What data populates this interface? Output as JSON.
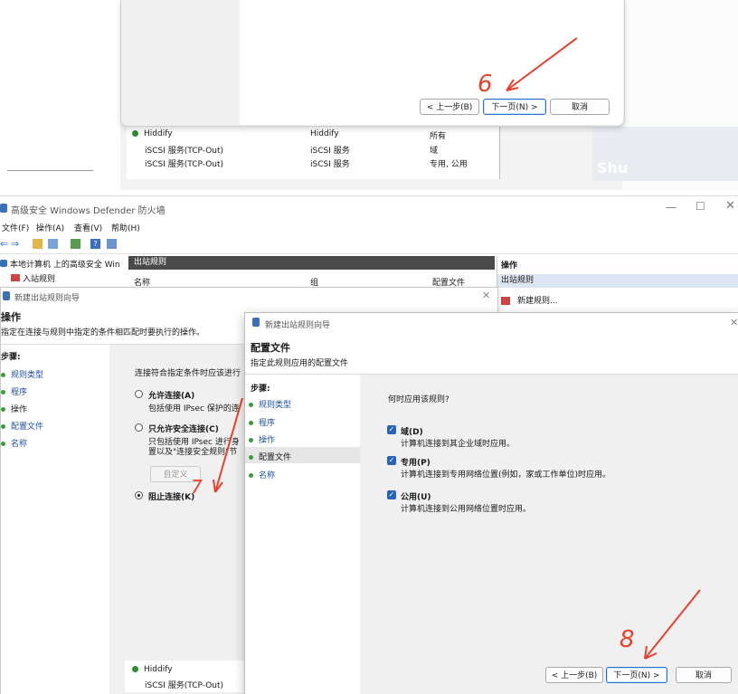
{
  "top_dialog": {
    "back_button": "< 上一步(B)",
    "next_button": "下一页(N) >",
    "cancel_button": "取消",
    "rows": [
      {
        "name": "Hiddify",
        "group": "Hiddify",
        "profile": "所有"
      },
      {
        "name": "iSCSI 服务(TCP-Out)",
        "group": "iSCSI 服务",
        "profile": "域"
      },
      {
        "name": "iSCSI 服务(TCP-Out)",
        "group": "iSCSI 服务",
        "profile": "专用, 公用"
      }
    ],
    "annotation": "6",
    "watermark": "Shu"
  },
  "main_window": {
    "title": "高级安全 Windows Defender 防火墙",
    "menu": [
      "文件(F)",
      "操作(A)",
      "查看(V)",
      "帮助(H)"
    ],
    "tree": {
      "root": "本地计算机 上的高级安全 Win",
      "inbound": "入站规则"
    },
    "center_header": "出站规则",
    "columns": {
      "name": "名称",
      "group": "组",
      "profile": "配置文件"
    },
    "actions_title": "操作",
    "actions_section": "出站规则",
    "actions_new_rule": "新建规则..."
  },
  "dialog_back": {
    "title": "新建出站规则向导",
    "heading": "操作",
    "subheading": "指定在连接与规则中指定的条件相匹配时要执行的操作。",
    "steps_label": "步骤:",
    "steps": [
      "规则类型",
      "程序",
      "操作",
      "配置文件",
      "名称"
    ],
    "question": "连接符合指定条件时应该进行",
    "option_allow": "允许连接(A)",
    "option_allow_desc": "包括使用 IPsec 保护的连",
    "option_secure": "只允许安全连接(C)",
    "option_secure_desc1": "只包括使用 IPsec 进行身",
    "option_secure_desc2": "置以及\"连接安全规则\"节",
    "customize_button": "自定义",
    "option_block": "阻止连接(K)",
    "annotation": "7"
  },
  "dialog_front": {
    "title": "新建出站规则向导",
    "heading": "配置文件",
    "subheading": "指定此规则应用的配置文件",
    "steps_label": "步骤:",
    "steps": [
      "规则类型",
      "程序",
      "操作",
      "配置文件",
      "名称"
    ],
    "question": "何时应用该规则?",
    "profiles": [
      {
        "label": "域(D)",
        "desc": "计算机连接到其企业域时应用。"
      },
      {
        "label": "专用(P)",
        "desc": "计算机连接到专用网络位置(例如，家或工作单位)时应用。"
      },
      {
        "label": "公用(U)",
        "desc": "计算机连接到公用网络位置时应用。"
      }
    ],
    "back_button": "< 上一步(B)",
    "next_button": "下一页(N) >",
    "cancel_button": "取消",
    "annotation": "8"
  },
  "bottom_rows": [
    {
      "name": "Hiddify"
    },
    {
      "name": "iSCSI 服务(TCP-Out)"
    }
  ],
  "colors": {
    "accent": "#2a62b8",
    "annotation": "#e8402a",
    "header_dark": "#4a4a4a",
    "selected": "#dce6f2"
  }
}
